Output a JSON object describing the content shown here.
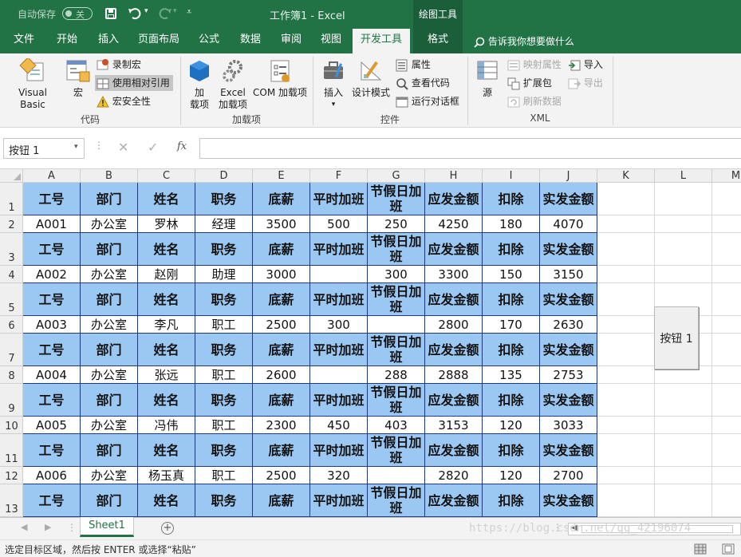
{
  "titlebar": {
    "autosave_label": "自动保存",
    "autosave_state": "关",
    "doc_title": "工作簿1 - Excel",
    "context_tab": "绘图工具"
  },
  "tabs": [
    "文件",
    "开始",
    "插入",
    "页面布局",
    "公式",
    "数据",
    "审阅",
    "视图",
    "开发工具",
    "格式"
  ],
  "active_tab": "开发工具",
  "tell_me": "告诉我你想要做什么",
  "ribbon": {
    "code": {
      "visual_basic": "Visual Basic",
      "macros": "宏",
      "record_macro": "录制宏",
      "use_relative": "使用相对引用",
      "macro_security": "宏安全性",
      "label": "代码"
    },
    "addins": {
      "addins": [
        "加",
        "载项"
      ],
      "excel_addins": [
        "Excel",
        "加载项"
      ],
      "com_addins": "COM 加载项",
      "label": "加载项"
    },
    "controls": {
      "insert": "插入",
      "design_mode": "设计模式",
      "properties": "属性",
      "view_code": "查看代码",
      "run_dialog": "运行对话框",
      "label": "控件"
    },
    "xml": {
      "source": "源",
      "map_properties": "映射属性",
      "expansion_packs": "扩展包",
      "refresh_data": "刷新数据",
      "import": "导入",
      "export": "导出",
      "label": "XML"
    }
  },
  "formula_bar": {
    "name_box": "按钮 1",
    "fx": "fx",
    "formula": ""
  },
  "columns": [
    "A",
    "B",
    "C",
    "D",
    "E",
    "F",
    "G",
    "H",
    "I",
    "J",
    "K",
    "L",
    "M"
  ],
  "rows": [
    "1",
    "2",
    "3",
    "4",
    "5",
    "6",
    "7",
    "8",
    "9",
    "10",
    "11",
    "12",
    "13"
  ],
  "header_row": [
    "工号",
    "部门",
    "姓名",
    "职务",
    "底薪",
    "平时加班",
    "节假日加班",
    "应发金额",
    "扣除",
    "实发金额"
  ],
  "records": [
    [
      "A001",
      "办公室",
      "罗林",
      "经理",
      "3500",
      "500",
      "250",
      "4250",
      "180",
      "4070"
    ],
    [
      "A002",
      "办公室",
      "赵刚",
      "助理",
      "3000",
      "",
      "300",
      "3300",
      "150",
      "3150"
    ],
    [
      "A003",
      "办公室",
      "李凡",
      "职工",
      "2500",
      "300",
      "",
      "2800",
      "170",
      "2630"
    ],
    [
      "A004",
      "办公室",
      "张远",
      "职工",
      "2600",
      "",
      "288",
      "2888",
      "135",
      "2753"
    ],
    [
      "A005",
      "办公室",
      "冯伟",
      "职工",
      "2300",
      "450",
      "403",
      "3153",
      "120",
      "3033"
    ],
    [
      "A006",
      "办公室",
      "杨玉真",
      "职工",
      "2500",
      "320",
      "",
      "2820",
      "120",
      "2700"
    ]
  ],
  "button": {
    "label": "按钮 1"
  },
  "sheet_tab": "Sheet1",
  "status_text": "选定目标区域，然后按 ENTER 或选择“粘贴”",
  "watermark": "https://blog.csdn.net/qq_42196074",
  "colors": {
    "excel_green": "#217346",
    "header_fill": "#9bc8f3",
    "border_blue": "#1f3b80"
  }
}
